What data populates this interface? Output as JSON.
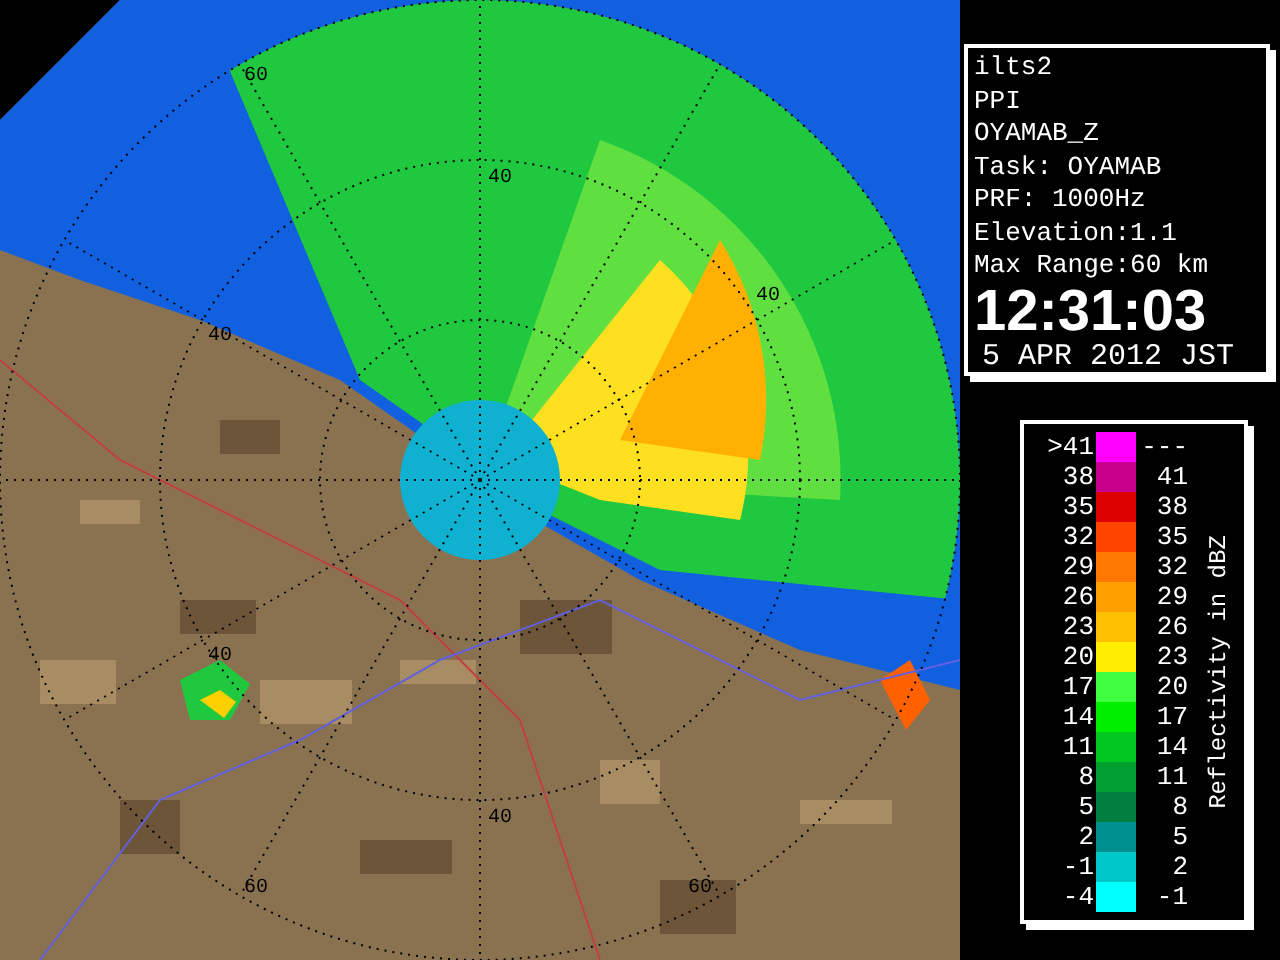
{
  "radar_map": {
    "range_labels": [
      {
        "text": "60"
      },
      {
        "text": "40"
      },
      {
        "text": "40"
      },
      {
        "text": "40"
      },
      {
        "text": "40"
      },
      {
        "text": "40"
      },
      {
        "text": "60"
      },
      {
        "text": "60"
      }
    ]
  },
  "info": {
    "lines": [
      "ilts2",
      "PPI",
      "OYAMAB_Z",
      "Task: OYAMAB",
      "PRF: 1000Hz",
      "Elevation:1.1",
      "Max Range:60 km"
    ],
    "time": "12:31:03",
    "date": "5 APR 2012 JST"
  },
  "legend": {
    "title": "Reflectivity in dBZ",
    "rows": [
      {
        "low": ">41",
        "high": "---",
        "color": "#ff00ff"
      },
      {
        "low": "38",
        "high": "41",
        "color": "#c8008c"
      },
      {
        "low": "35",
        "high": "38",
        "color": "#dd0000"
      },
      {
        "low": "32",
        "high": "35",
        "color": "#ff4400"
      },
      {
        "low": "29",
        "high": "32",
        "color": "#ff7800"
      },
      {
        "low": "26",
        "high": "29",
        "color": "#ffa000"
      },
      {
        "low": "23",
        "high": "26",
        "color": "#ffc000"
      },
      {
        "low": "20",
        "high": "23",
        "color": "#ffee00"
      },
      {
        "low": "17",
        "high": "20",
        "color": "#40ff40"
      },
      {
        "low": "14",
        "high": "17",
        "color": "#00ee00"
      },
      {
        "low": "11",
        "high": "14",
        "color": "#00c820"
      },
      {
        "low": "8",
        "high": "11",
        "color": "#00a030"
      },
      {
        "low": "5",
        "high": "8",
        "color": "#008040"
      },
      {
        "low": "2",
        "high": "5",
        "color": "#009090"
      },
      {
        "low": "-1",
        "high": "2",
        "color": "#00c8c8"
      },
      {
        "low": "-4",
        "high": "-1",
        "color": "#00ffff"
      }
    ]
  }
}
